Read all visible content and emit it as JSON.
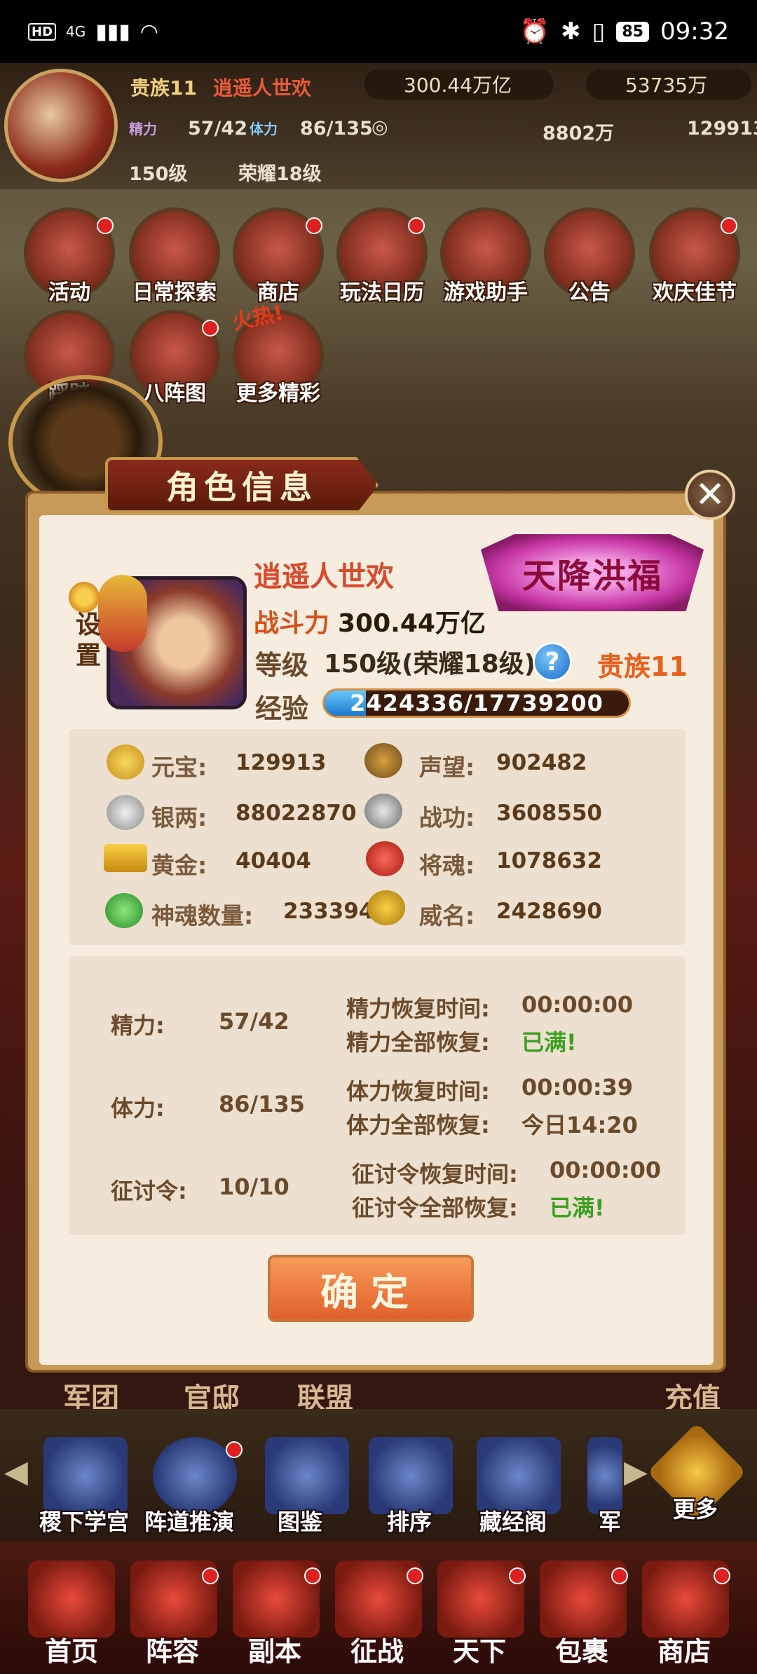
{
  "status_bar": {
    "left_hd": "HD",
    "left_net": "4G",
    "battery": "85",
    "time": "09:32"
  },
  "top_hud": {
    "vip": "贵族11",
    "player_name": "逍遥人世欢",
    "power": "300.44万亿",
    "paw_value": "53735万",
    "jingli_tag": "精力",
    "jingli": "57/42",
    "tili_tag": "体力",
    "tili": "86/135",
    "silver": "8802万",
    "yuanbao": "129913",
    "level": "150级",
    "glory": "荣耀18级"
  },
  "menu_icons": [
    {
      "label": "活动"
    },
    {
      "label": "日常探索"
    },
    {
      "label": "商店"
    },
    {
      "label": "玩法日历"
    },
    {
      "label": "游戏助手"
    },
    {
      "label": "公告"
    },
    {
      "label": "欢庆佳节"
    },
    {
      "label": "踩踏"
    },
    {
      "label": "八阵图"
    },
    {
      "label": "更多精彩"
    }
  ],
  "hot_tag": "火热!",
  "dialog": {
    "title": "角色信息",
    "close": "✕",
    "settings": "设置",
    "name": "逍遥人世欢",
    "power_label": "战斗力",
    "power_value": "300.44万亿",
    "level_label": "等级",
    "level_value": "150级(荣耀18级)",
    "help": "?",
    "noble": "贵族11",
    "exp_label": "经验",
    "exp_value": "2424336/17739200",
    "exp_progress": 0.1367,
    "fortune": "天降洪福",
    "resources": [
      {
        "label": "元宝:",
        "value": "129913",
        "icon": "gold-ingot-icon"
      },
      {
        "label": "声望:",
        "value": "902482",
        "icon": "prestige-icon"
      },
      {
        "label": "银两:",
        "value": "88022870",
        "icon": "silver-coin-icon"
      },
      {
        "label": "战功:",
        "value": "3608550",
        "icon": "merit-icon"
      },
      {
        "label": "黄金:",
        "value": "40404",
        "icon": "gold-bar-icon"
      },
      {
        "label": "将魂:",
        "value": "1078632",
        "icon": "general-soul-icon"
      },
      {
        "label": "神魂数量:",
        "value": "2333946",
        "icon": "divine-soul-icon"
      },
      {
        "label": "威名:",
        "value": "2428690",
        "icon": "fame-icon"
      }
    ],
    "stats": [
      {
        "label": "精力:",
        "value": "57/42",
        "line1_label": "精力恢复时间:",
        "line1_value": "00:00:00",
        "line2_label": "精力全部恢复:",
        "line2_value": "已满!"
      },
      {
        "label": "体力:",
        "value": "86/135",
        "line1_label": "体力恢复时间:",
        "line1_value": "00:00:39",
        "line2_label": "体力全部恢复:",
        "line2_value": "今日14:20"
      },
      {
        "label": "征讨令:",
        "value": "10/10",
        "line1_label": "征讨令恢复时间:",
        "line1_value": "00:00:00",
        "line2_label": "征讨令全部恢复:",
        "line2_value": "已满!"
      }
    ],
    "confirm": "确定"
  },
  "bottom_tabs": [
    "军团",
    "官邸",
    "联盟",
    "充值"
  ],
  "function_bar": [
    {
      "label": "稷下学宫"
    },
    {
      "label": "阵道推演"
    },
    {
      "label": "图鉴"
    },
    {
      "label": "排序"
    },
    {
      "label": "藏经阁"
    },
    {
      "label": "军"
    },
    {
      "label": "更多"
    }
  ],
  "nav": [
    {
      "label": "首页"
    },
    {
      "label": "阵容"
    },
    {
      "label": "副本"
    },
    {
      "label": "征战"
    },
    {
      "label": "天下"
    },
    {
      "label": "包裹"
    },
    {
      "label": "商店"
    }
  ]
}
